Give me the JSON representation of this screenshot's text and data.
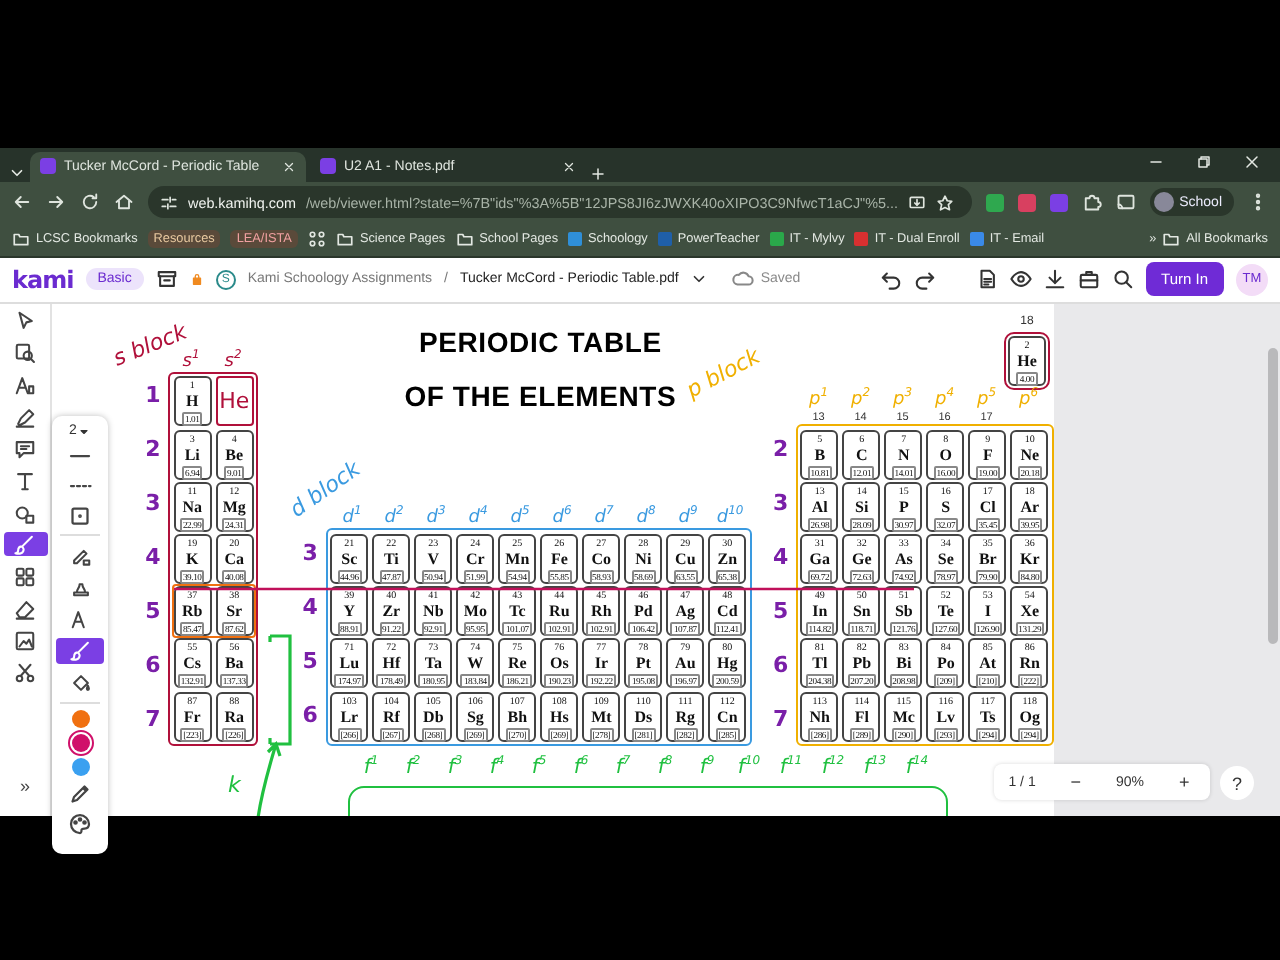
{
  "browser": {
    "tabs": [
      {
        "title": "Tucker McCord - Periodic Table",
        "selected": true
      },
      {
        "title": "U2 A1 - Notes.pdf",
        "selected": false
      }
    ],
    "url_host": "web.kamihq.com",
    "url_path": "/web/viewer.html?state=%7B\"ids\"%3A%5B\"12JPS8JI6zJWXK40oXIPO3C9NfwcT1aCJ\"%5...",
    "profile": "School",
    "bookmarks": [
      {
        "kind": "folder",
        "label": "LCSC Bookmarks"
      },
      {
        "kind": "chip",
        "label": "Resources",
        "color": "#e8c9a0"
      },
      {
        "kind": "chip",
        "label": "LEA/ISTA",
        "color": "#f0a0a0"
      },
      {
        "kind": "apps"
      },
      {
        "kind": "folder",
        "label": "Science Pages"
      },
      {
        "kind": "folder",
        "label": "School Pages"
      },
      {
        "kind": "link",
        "label": "Schoology",
        "color": "#2f8fd8"
      },
      {
        "kind": "link",
        "label": "PowerTeacher",
        "color": "#1f5fa8"
      },
      {
        "kind": "link",
        "label": "IT - Mylvy",
        "color": "#2aa84a"
      },
      {
        "kind": "link",
        "label": "IT - Dual Enroll",
        "color": "#d83030"
      },
      {
        "kind": "link",
        "label": "IT - Email",
        "color": "#3a8ae8"
      }
    ],
    "more": "»",
    "all_bookmarks": "All Bookmarks"
  },
  "kami": {
    "logo": "kami",
    "plan": "Basic",
    "workspace_initial": "S",
    "folder": "Kami Schoology Assignments",
    "separator": "/",
    "file": "Tucker McCord - Periodic Table.pdf",
    "status": "Saved",
    "turn_in": "Turn In",
    "avatar": "TM"
  },
  "left_tools": [
    {
      "selected": false
    },
    {
      "selected": false
    },
    {
      "selected": false
    },
    {
      "selected": false
    },
    {
      "selected": false
    },
    {
      "selected": false
    },
    {
      "selected": false
    },
    {
      "selected": true
    },
    {
      "selected": false
    },
    {
      "selected": false
    },
    {
      "selected": false
    },
    {
      "selected": false
    }
  ],
  "expand": "»",
  "palette": {
    "size": "2",
    "tools": [
      {
        "selected": false
      },
      {
        "selected": false
      },
      {
        "selected": false
      },
      {
        "selected": true
      },
      {
        "selected": false
      }
    ],
    "colors": [
      {
        "color": "#f07010",
        "selected": false
      },
      {
        "color": "#d0106a",
        "selected": true
      },
      {
        "color": "#3aa0f0",
        "selected": false
      }
    ]
  },
  "document": {
    "title": [
      "PERIODIC TABLE",
      "OF THE ELEMENTS"
    ],
    "s_block": {
      "label": "s block",
      "color": "#b0103a",
      "column_labels": [
        "s$^{1}$",
        "s$^{2}$"
      ],
      "row_labels": [
        "1",
        "2",
        "3",
        "4",
        "5",
        "6",
        "7"
      ],
      "rows": [
        {
          "circled": false,
          "note": "He",
          "elements": [
            {
              "number": "1",
              "symbol": "H",
              "mass": "1.01"
            }
          ]
        },
        {
          "circled": false,
          "elements": [
            {
              "number": "3",
              "symbol": "Li",
              "mass": "6.94"
            },
            {
              "number": "4",
              "symbol": "Be",
              "mass": "9.01"
            }
          ]
        },
        {
          "circled": false,
          "elements": [
            {
              "number": "11",
              "symbol": "Na",
              "mass": "22.99"
            },
            {
              "number": "12",
              "symbol": "Mg",
              "mass": "24.31"
            }
          ]
        },
        {
          "circled": false,
          "elements": [
            {
              "number": "19",
              "symbol": "K",
              "mass": "39.10"
            },
            {
              "number": "20",
              "symbol": "Ca",
              "mass": "40.08"
            }
          ]
        },
        {
          "circled": true,
          "elements": [
            {
              "number": "37",
              "symbol": "Rb",
              "mass": "85.47"
            },
            {
              "number": "38",
              "symbol": "Sr",
              "mass": "87.62"
            }
          ]
        },
        {
          "circled": false,
          "elements": [
            {
              "number": "55",
              "symbol": "Cs",
              "mass": "132.91"
            },
            {
              "number": "56",
              "symbol": "Ba",
              "mass": "137.33"
            }
          ]
        },
        {
          "circled": false,
          "elements": [
            {
              "number": "87",
              "symbol": "Fr",
              "mass": "[223]"
            },
            {
              "number": "88",
              "symbol": "Ra",
              "mass": "[226]"
            }
          ]
        }
      ]
    },
    "d_block": {
      "label": "d block",
      "color": "#3a9ae0",
      "column_labels": [
        "d$^{1}$",
        "d$^{2}$",
        "d$^{3}$",
        "d$^{4}$",
        "d$^{5}$",
        "d$^{6}$",
        "d$^{7}$",
        "d$^{8}$",
        "d$^{9}$",
        "d$^{10}$"
      ],
      "row_labels": [
        "3",
        "4",
        "5",
        "6"
      ],
      "rows": [
        {
          "circled": false,
          "elements": [
            {
              "number": "21",
              "symbol": "Sc",
              "mass": "44.96"
            },
            {
              "number": "22",
              "symbol": "Ti",
              "mass": "47.87"
            },
            {
              "number": "23",
              "symbol": "V",
              "mass": "50.94"
            },
            {
              "number": "24",
              "symbol": "Cr",
              "mass": "51.99"
            },
            {
              "number": "25",
              "symbol": "Mn",
              "mass": "54.94"
            },
            {
              "number": "26",
              "symbol": "Fe",
              "mass": "55.85"
            },
            {
              "number": "27",
              "symbol": "Co",
              "mass": "58.93"
            },
            {
              "number": "28",
              "symbol": "Ni",
              "mass": "58.69"
            },
            {
              "number": "29",
              "symbol": "Cu",
              "mass": "63.55"
            },
            {
              "number": "30",
              "symbol": "Zn",
              "mass": "65.38"
            }
          ]
        },
        {
          "circled": false,
          "elements": [
            {
              "number": "39",
              "symbol": "Y",
              "mass": "88.91"
            },
            {
              "number": "40",
              "symbol": "Zr",
              "mass": "91.22"
            },
            {
              "number": "41",
              "symbol": "Nb",
              "mass": "92.91"
            },
            {
              "number": "42",
              "symbol": "Mo",
              "mass": "95.95"
            },
            {
              "number": "43",
              "symbol": "Tc",
              "mass": "101.07"
            },
            {
              "number": "44",
              "symbol": "Ru",
              "mass": "102.91"
            },
            {
              "number": "45",
              "symbol": "Rh",
              "mass": "102.91"
            },
            {
              "number": "46",
              "symbol": "Pd",
              "mass": "106.42"
            },
            {
              "number": "47",
              "symbol": "Ag",
              "mass": "107.87"
            },
            {
              "number": "48",
              "symbol": "Cd",
              "mass": "112.41"
            }
          ]
        },
        {
          "circled": false,
          "elements": [
            {
              "number": "71",
              "symbol": "Lu",
              "mass": "174.97"
            },
            {
              "number": "72",
              "symbol": "Hf",
              "mass": "178.49"
            },
            {
              "number": "73",
              "symbol": "Ta",
              "mass": "180.95"
            },
            {
              "number": "74",
              "symbol": "W",
              "mass": "183.84"
            },
            {
              "number": "75",
              "symbol": "Re",
              "mass": "186.21"
            },
            {
              "number": "76",
              "symbol": "Os",
              "mass": "190.23"
            },
            {
              "number": "77",
              "symbol": "Ir",
              "mass": "192.22"
            },
            {
              "number": "78",
              "symbol": "Pt",
              "mass": "195.08"
            },
            {
              "number": "79",
              "symbol": "Au",
              "mass": "196.97"
            },
            {
              "number": "80",
              "symbol": "Hg",
              "mass": "200.59"
            }
          ]
        },
        {
          "circled": false,
          "elements": [
            {
              "number": "103",
              "symbol": "Lr",
              "mass": "[266]"
            },
            {
              "number": "104",
              "symbol": "Rf",
              "mass": "[267]"
            },
            {
              "number": "105",
              "symbol": "Db",
              "mass": "[268]"
            },
            {
              "number": "106",
              "symbol": "Sg",
              "mass": "[269]"
            },
            {
              "number": "107",
              "symbol": "Bh",
              "mass": "[270]"
            },
            {
              "number": "108",
              "symbol": "Hs",
              "mass": "[269]"
            },
            {
              "number": "109",
              "symbol": "Mt",
              "mass": "[278]"
            },
            {
              "number": "110",
              "symbol": "Ds",
              "mass": "[281]"
            },
            {
              "number": "111",
              "symbol": "Rg",
              "mass": "[282]"
            },
            {
              "number": "112",
              "symbol": "Cn",
              "mass": "[285]"
            }
          ]
        }
      ]
    },
    "p_block": {
      "label": "p block",
      "color": "#f0b000",
      "column_labels": [
        "p$^{1}$",
        "p$^{2}$",
        "p$^{3}$",
        "p$^{4}$",
        "p$^{5}$",
        "p$^{6}$"
      ],
      "group_numbers": [
        "13",
        "14",
        "15",
        "16",
        "17"
      ],
      "row_labels": [
        "2",
        "3",
        "4",
        "5",
        "6",
        "7"
      ],
      "top": {
        "group_number": "18",
        "circled": true,
        "element": {
          "number": "2",
          "symbol": "He",
          "mass": "4.00"
        }
      },
      "rows": [
        {
          "circled": false,
          "elements": [
            {
              "number": "5",
              "symbol": "B",
              "mass": "10.81"
            },
            {
              "number": "6",
              "symbol": "C",
              "mass": "12.01"
            },
            {
              "number": "7",
              "symbol": "N",
              "mass": "14.01"
            },
            {
              "number": "8",
              "symbol": "O",
              "mass": "16.00"
            },
            {
              "number": "9",
              "symbol": "F",
              "mass": "19.00"
            },
            {
              "number": "10",
              "symbol": "Ne",
              "mass": "20.18"
            }
          ]
        },
        {
          "circled": false,
          "elements": [
            {
              "number": "13",
              "symbol": "Al",
              "mass": "26.98"
            },
            {
              "number": "14",
              "symbol": "Si",
              "mass": "28.09"
            },
            {
              "number": "15",
              "symbol": "P",
              "mass": "30.97"
            },
            {
              "number": "16",
              "symbol": "S",
              "mass": "32.07"
            },
            {
              "number": "17",
              "symbol": "Cl",
              "mass": "35.45"
            },
            {
              "number": "18",
              "symbol": "Ar",
              "mass": "39.95"
            }
          ]
        },
        {
          "circled": false,
          "elements": [
            {
              "number": "31",
              "symbol": "Ga",
              "mass": "69.72"
            },
            {
              "number": "32",
              "symbol": "Ge",
              "mass": "72.63"
            },
            {
              "number": "33",
              "symbol": "As",
              "mass": "74.92"
            },
            {
              "number": "34",
              "symbol": "Se",
              "mass": "78.97"
            },
            {
              "number": "35",
              "symbol": "Br",
              "mass": "79.90"
            },
            {
              "number": "36",
              "symbol": "Kr",
              "mass": "84.80"
            }
          ]
        },
        {
          "circled": false,
          "elements": [
            {
              "number": "49",
              "symbol": "In",
              "mass": "114.82"
            },
            {
              "number": "50",
              "symbol": "Sn",
              "mass": "118.71"
            },
            {
              "number": "51",
              "symbol": "Sb",
              "mass": "121.76"
            },
            {
              "number": "52",
              "symbol": "Te",
              "mass": "127.60"
            },
            {
              "number": "53",
              "symbol": "I",
              "mass": "126.90"
            },
            {
              "number": "54",
              "symbol": "Xe",
              "mass": "131.29"
            }
          ]
        },
        {
          "circled": false,
          "elements": [
            {
              "number": "81",
              "symbol": "Tl",
              "mass": "204.38"
            },
            {
              "number": "82",
              "symbol": "Pb",
              "mass": "207.20"
            },
            {
              "number": "83",
              "symbol": "Bi",
              "mass": "208.98"
            },
            {
              "number": "84",
              "symbol": "Po",
              "mass": "[209]"
            },
            {
              "number": "85",
              "symbol": "At",
              "mass": "[210]"
            },
            {
              "number": "86",
              "symbol": "Rn",
              "mass": "[222]"
            }
          ]
        },
        {
          "circled": false,
          "elements": [
            {
              "number": "113",
              "symbol": "Nh",
              "mass": "[286]"
            },
            {
              "number": "114",
              "symbol": "Fl",
              "mass": "[289]"
            },
            {
              "number": "115",
              "symbol": "Mc",
              "mass": "[290]"
            },
            {
              "number": "116",
              "symbol": "Lv",
              "mass": "[293]"
            },
            {
              "number": "117",
              "symbol": "Ts",
              "mass": "[294]"
            },
            {
              "number": "118",
              "symbol": "Og",
              "mass": "[294]"
            }
          ]
        }
      ]
    },
    "f_block": {
      "label": "k",
      "color": "#20c040",
      "column_labels": [
        "f$^{1}$",
        "f$^{2}$",
        "f$^{3}$",
        "f$^{4}$",
        "f$^{5}$",
        "f$^{6}$",
        "f$^{7}$",
        "f$^{8}$",
        "f$^{9}$",
        "f$^{10}$",
        "f$^{11}$",
        "f$^{12}$",
        "f$^{13}$",
        "f$^{14}$"
      ]
    }
  },
  "page_nav": {
    "page": "1 / 1",
    "zoom_out": "−",
    "zoom": "90%",
    "zoom_in": "+",
    "help": "?"
  }
}
